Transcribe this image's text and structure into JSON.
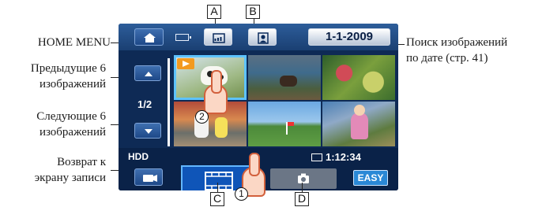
{
  "screen": {
    "date_button": "1-1-2009",
    "page_indicator": "1/2",
    "storage": "HDD",
    "duration": "1:12:34",
    "easy_button": "EASY"
  },
  "annotations": {
    "home_menu": "HOME MENU",
    "prev_6": [
      "Предыдущие 6",
      "изображений"
    ],
    "next_6": [
      "Следующие 6",
      "изображений"
    ],
    "return": [
      "Возврат к",
      "экрану записи"
    ],
    "date_search": [
      "Поиск изображений",
      "по дате (стр. 41)"
    ]
  },
  "callouts": {
    "a": "A",
    "b": "B",
    "c": "C",
    "d": "D",
    "one": "1",
    "two": "2"
  },
  "icons": [
    "home-icon",
    "battery-icon",
    "date-index-icon",
    "face-index-icon",
    "arrow-up-icon",
    "arrow-down-icon",
    "camera-record-icon",
    "film-icon",
    "photo-camera-icon",
    "play-badge-icon"
  ],
  "colors": {
    "screen_bg": "#0e2a55",
    "highlight": "#5ec3ff",
    "selected_tab": "#0f55b8",
    "tab_underline": "#ff6a1a",
    "easy": "#2a88d6"
  }
}
